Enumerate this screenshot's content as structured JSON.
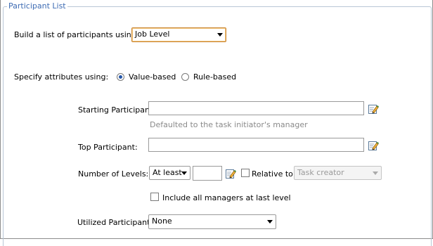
{
  "group": {
    "legend": "Participant List"
  },
  "build_list": {
    "label": "Build a list of participants using:",
    "value": "Job Level"
  },
  "attributes": {
    "label": "Specify attributes using:",
    "options": [
      {
        "label": "Value-based",
        "selected": true
      },
      {
        "label": "Rule-based",
        "selected": false
      }
    ]
  },
  "starting_participant": {
    "label": "Starting Participant:",
    "value": "",
    "hint": "Defaulted to the task initiator's manager"
  },
  "top_participant": {
    "label": "Top Participant:",
    "value": ""
  },
  "levels": {
    "label": "Number of Levels:",
    "mode": "At least",
    "count": "",
    "relative_label": "Relative to:",
    "relative_checked": false,
    "relative_value": "Task creator"
  },
  "include_managers": {
    "label": "Include all managers at last level",
    "checked": false
  },
  "utilized": {
    "label": "Utilized Participants:",
    "value": "None"
  },
  "icons": {
    "edit": "edit-pencil-icon"
  }
}
